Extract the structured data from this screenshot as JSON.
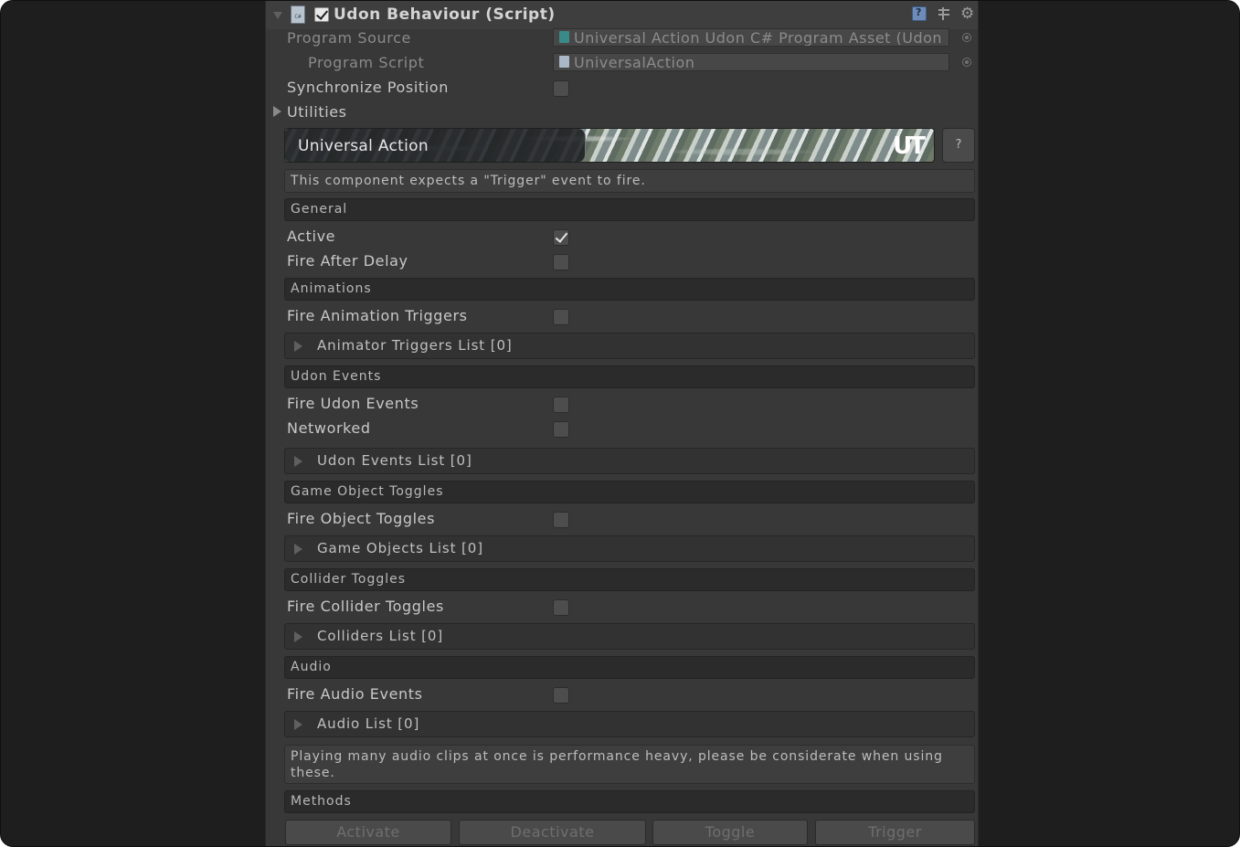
{
  "header": {
    "title": "Udon Behaviour (Script)",
    "enabled": true
  },
  "program": {
    "source_label": "Program Source",
    "source_value": "Universal Action Udon C# Program Asset (Udon",
    "script_label": "Program Script",
    "script_value": "UniversalAction"
  },
  "sync_position": {
    "label": "Synchronize Position",
    "checked": false
  },
  "utilities_label": "Utilities",
  "banner": {
    "title": "Universal Action",
    "logo": "UT",
    "help": "?"
  },
  "info": "This component expects a \"Trigger\" event to fire.",
  "sections": {
    "general": "General",
    "animations": "Animations",
    "udon_events": "Udon Events",
    "game_object_toggles": "Game Object Toggles",
    "collider_toggles": "Collider Toggles",
    "audio": "Audio",
    "methods": "Methods"
  },
  "fields": {
    "active": {
      "label": "Active",
      "checked": true
    },
    "fire_after_delay": {
      "label": "Fire After Delay",
      "checked": false
    },
    "fire_animation_triggers": {
      "label": "Fire Animation Triggers",
      "checked": false
    },
    "fire_udon_events": {
      "label": "Fire Udon Events",
      "checked": false
    },
    "networked": {
      "label": "Networked",
      "checked": false
    },
    "fire_object_toggles": {
      "label": "Fire Object Toggles",
      "checked": false
    },
    "fire_collider_toggles": {
      "label": "Fire Collider Toggles",
      "checked": false
    },
    "fire_audio_events": {
      "label": "Fire Audio Events",
      "checked": false
    }
  },
  "lists": {
    "animator_triggers": "Animator Triggers List [0]",
    "udon_events": "Udon Events List [0]",
    "game_objects": "Game Objects List [0]",
    "colliders": "Colliders List [0]",
    "audio": "Audio List [0]"
  },
  "audio_warning": "Playing many audio clips at once is performance heavy, please be considerate when using these.",
  "methods": {
    "activate": "Activate",
    "deactivate": "Deactivate",
    "toggle": "Toggle",
    "trigger": "Trigger"
  },
  "icons": {
    "header": [
      "foldout-arrow-icon",
      "script-icon",
      "help-book-icon",
      "preset-icon",
      "gear-icon"
    ],
    "program_source": "udon-asset-icon",
    "program_script": "csharp-script-icon",
    "picker": "object-picker-icon"
  },
  "colors": {
    "background": "#383838",
    "section": "#2b2b2b",
    "text": "#c8c8c8"
  }
}
